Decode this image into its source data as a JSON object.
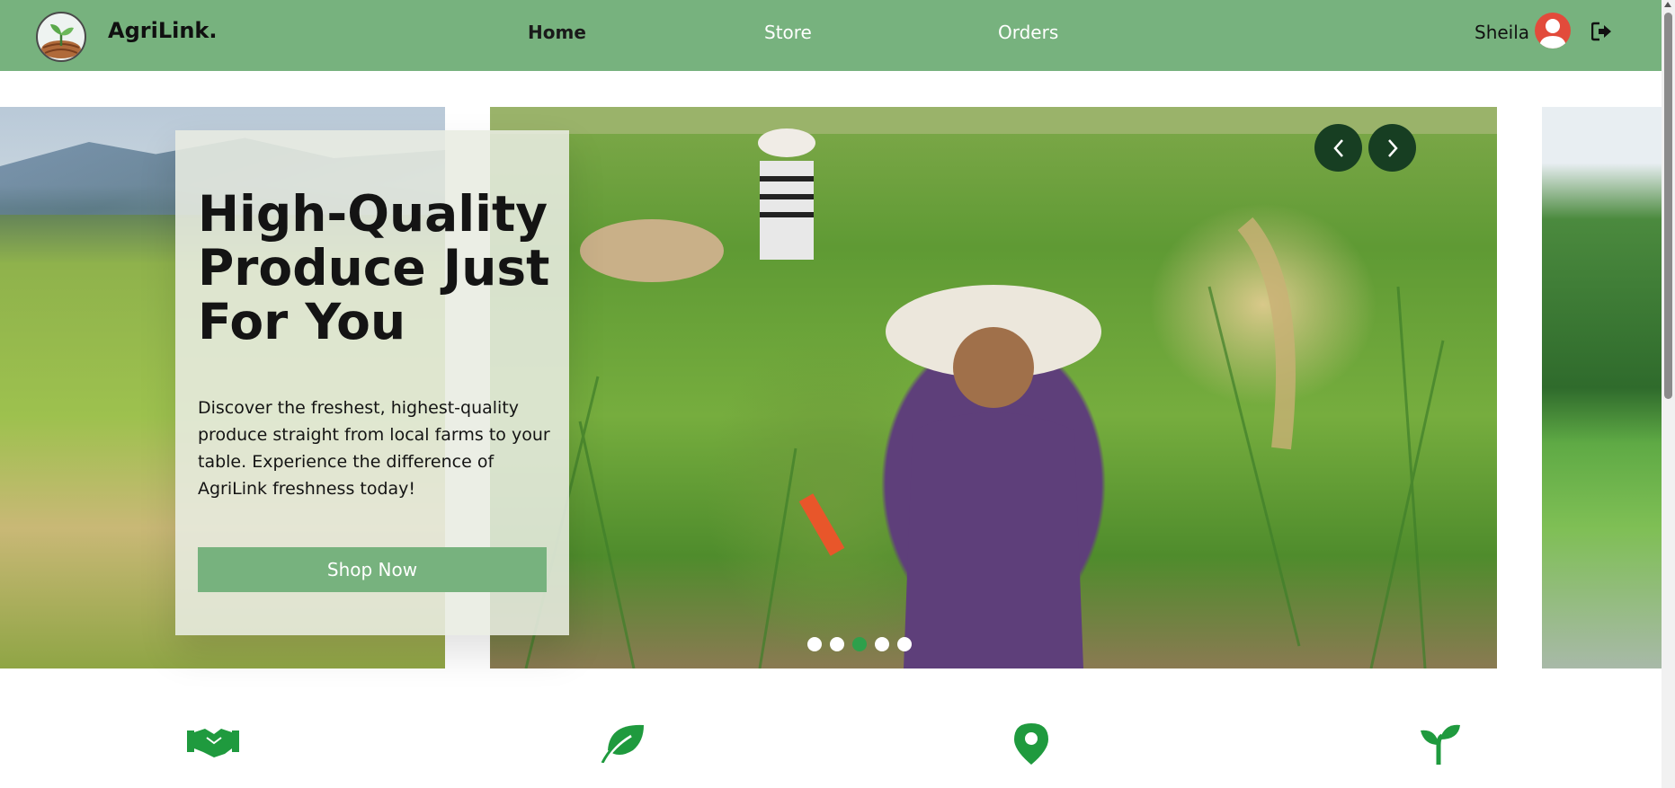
{
  "header": {
    "brand": "AgriLink.",
    "nav": {
      "home": "Home",
      "store": "Store",
      "orders": "Orders"
    },
    "user_name": "Sheila"
  },
  "hero": {
    "title": "High-Quality Produce Just For You",
    "description": "Discover the freshest, highest-quality produce straight from local farms to your table. Experience the difference of AgriLink freshness today!",
    "cta_label": "Shop Now"
  },
  "carousel": {
    "slide_count": 5,
    "active_slide": 3
  },
  "features": {
    "icons": [
      "handshake-icon",
      "leaf-icon",
      "location-pin-icon",
      "sprout-icon"
    ]
  },
  "colors": {
    "nav_bg": "#77b27e",
    "accent_green": "#2ea04b",
    "carousel_btn": "#173e22",
    "avatar": "#e24b3b"
  }
}
